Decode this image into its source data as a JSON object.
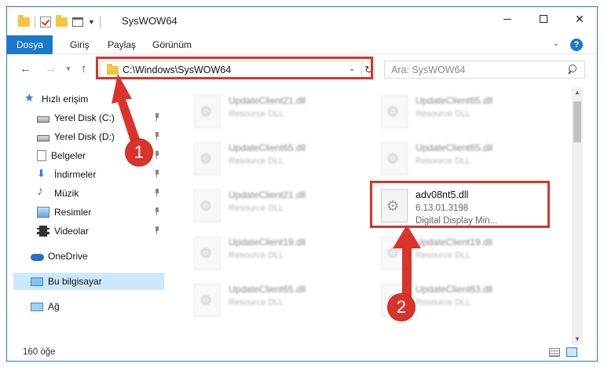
{
  "window": {
    "title": "SysWOW64"
  },
  "ribbon": {
    "tabs": [
      "Dosya",
      "Giriş",
      "Paylaş",
      "Görünüm"
    ],
    "help": "?"
  },
  "address": {
    "path": "C:\\Windows\\SysWOW64",
    "search_placeholder": "Ara: SysWOW64"
  },
  "sidebar": {
    "items": [
      {
        "label": "Hızlı erişim",
        "icon": "star-icon"
      },
      {
        "label": "Yerel Disk (C:)",
        "icon": "drive-icon"
      },
      {
        "label": "Yerel Disk (D:)",
        "icon": "drive-icon"
      },
      {
        "label": "Belgeler",
        "icon": "documents-icon"
      },
      {
        "label": "İndirmeler",
        "icon": "downloads-icon"
      },
      {
        "label": "Müzik",
        "icon": "music-icon"
      },
      {
        "label": "Resimler",
        "icon": "pictures-icon"
      },
      {
        "label": "Videolar",
        "icon": "videos-icon"
      },
      {
        "label": "OneDrive",
        "icon": "onedrive-icon"
      },
      {
        "label": "Bu bilgisayar",
        "icon": "pc-icon"
      },
      {
        "label": "Ağ",
        "icon": "network-icon"
      }
    ]
  },
  "files": [
    {
      "name": "UpdateClient21.dll",
      "type": "Resource DLL"
    },
    {
      "name": "UpdateClient65.dll",
      "type": "Resource DLL"
    },
    {
      "name": "UpdateClient65.dll",
      "type": "Resource DLL"
    },
    {
      "name": "UpdateClient65.dll",
      "type": "Resource DLL"
    },
    {
      "name": "UpdateClient21.dll",
      "type": "Resource DLL"
    },
    {
      "name": "adv08nt5.dll",
      "version": "6.13.01.3198",
      "description": "Digital Display Min..."
    },
    {
      "name": "UpdateClient19.dll",
      "type": "Resource DLL"
    },
    {
      "name": "UpdateClient19.dll",
      "type": "Resource DLL"
    },
    {
      "name": "UpdateClient65.dll",
      "type": "Resource DLL"
    },
    {
      "name": "UpdateClient63.dll",
      "type": "Resource DLL"
    }
  ],
  "status": {
    "count": "160 öğe"
  },
  "annotations": {
    "step1": "1",
    "step2": "2",
    "color": "#d9342b"
  }
}
